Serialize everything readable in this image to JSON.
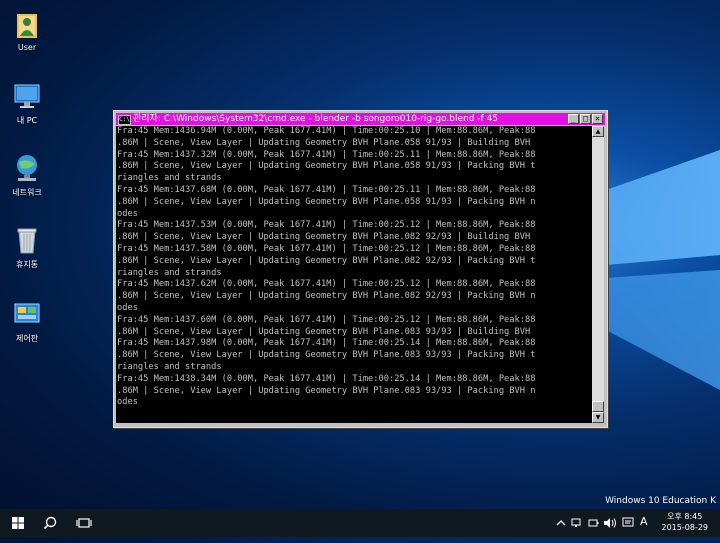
{
  "desktop": {
    "icons": [
      {
        "label": "User",
        "icon": "user-folder-icon"
      },
      {
        "label": "내 PC",
        "icon": "computer-icon"
      },
      {
        "label": "네트워크",
        "icon": "network-icon"
      },
      {
        "label": "휴지통",
        "icon": "recycle-bin-icon"
      },
      {
        "label": "제어판",
        "icon": "control-panel-icon"
      }
    ],
    "watermark": "Windows 10 Education K"
  },
  "console_window": {
    "title": "관리자: C:\\Windows\\System32\\cmd.exe - blender  -b songoro010-rig-go.blend -f 45",
    "title_color": "#e40fe4",
    "controls": {
      "minimize": "_",
      "maximize": "□",
      "close": "×"
    },
    "lines": [
      "Fra:45 Mem:1436.94M (0.00M, Peak 1677.41M) | Time:00:25.10 | Mem:88.86M, Peak:88",
      ".86M | Scene, View Layer | Updating Geometry BVH Plane.058 91/93 | Building BVH",
      "Fra:45 Mem:1437.32M (0.00M, Peak 1677.41M) | Time:00:25.11 | Mem:88.86M, Peak:88",
      ".86M | Scene, View Layer | Updating Geometry BVH Plane.058 91/93 | Packing BVH t",
      "riangles and strands",
      "Fra:45 Mem:1437.68M (0.00M, Peak 1677.41M) | Time:00:25.11 | Mem:88.86M, Peak:88",
      ".86M | Scene, View Layer | Updating Geometry BVH Plane.058 91/93 | Packing BVH n",
      "odes",
      "Fra:45 Mem:1437.53M (0.00M, Peak 1677.41M) | Time:00:25.12 | Mem:88.86M, Peak:88",
      ".86M | Scene, View Layer | Updating Geometry BVH Plane.082 92/93 | Building BVH",
      "Fra:45 Mem:1437.58M (0.00M, Peak 1677.41M) | Time:00:25.12 | Mem:88.86M, Peak:88",
      ".86M | Scene, View Layer | Updating Geometry BVH Plane.082 92/93 | Packing BVH t",
      "riangles and strands",
      "Fra:45 Mem:1437.62M (0.00M, Peak 1677.41M) | Time:00:25.12 | Mem:88.86M, Peak:88",
      ".86M | Scene, View Layer | Updating Geometry BVH Plane.082 92/93 | Packing BVH n",
      "odes",
      "Fra:45 Mem:1437.60M (0.00M, Peak 1677.41M) | Time:00:25.12 | Mem:88.86M, Peak:88",
      ".86M | Scene, View Layer | Updating Geometry BVH Plane.083 93/93 | Building BVH",
      "Fra:45 Mem:1437.98M (0.00M, Peak 1677.41M) | Time:00:25.14 | Mem:88.86M, Peak:88",
      ".86M | Scene, View Layer | Updating Geometry BVH Plane.083 93/93 | Packing BVH t",
      "riangles and strands",
      "Fra:45 Mem:1438.34M (0.00M, Peak 1677.41M) | Time:00:25.14 | Mem:88.86M, Peak:88",
      ".86M | Scene, View Layer | Updating Geometry BVH Plane.083 93/93 | Packing BVH n",
      "odes"
    ]
  },
  "taskbar": {
    "start_icon": "windows-start-icon",
    "search_icon": "search-icon",
    "task_view_icon": "task-view-icon",
    "tray": {
      "ime_label": "A",
      "clock_time": "오후 8:45",
      "clock_date": "2015-08-29"
    }
  }
}
